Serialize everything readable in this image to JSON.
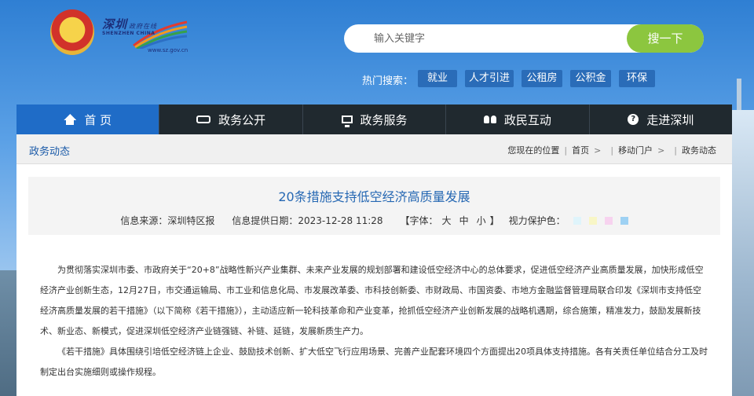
{
  "header": {
    "logo_cn": "深圳",
    "logo_cn_small": "政府在线",
    "logo_en": "SHENZHEN CHINA",
    "logo_url": "www.sz.gov.cn",
    "search_placeholder": "输入关键字",
    "search_button": "搜一下",
    "hot_label": "热门搜索：",
    "hot_tags": [
      "就业",
      "人才引进",
      "公租房",
      "公积金",
      "环保"
    ]
  },
  "nav": {
    "items": [
      {
        "label": "首 页",
        "icon": "home-icon"
      },
      {
        "label": "政务公开",
        "icon": "gov-icon"
      },
      {
        "label": "政务服务",
        "icon": "monitor-icon"
      },
      {
        "label": "政民互动",
        "icon": "people-icon"
      },
      {
        "label": "走进深圳",
        "icon": "info-icon"
      }
    ]
  },
  "crumb": {
    "section": "政务动态",
    "location_label": "您现在的位置",
    "path": [
      "首页",
      "移动门户",
      "政务动态"
    ]
  },
  "article": {
    "title": "20条措施支持低空经济高质量发展",
    "source_label": "信息来源：深圳特区报",
    "date_label": "信息提供日期：2023-12-28 11:28",
    "font_label": "【字体：",
    "font_large": "大",
    "font_medium": "中",
    "font_small": "小",
    "font_close": "】",
    "eye_label": "视力保护色：",
    "swatch_colors": [
      "#dff4fb",
      "#f8f6c6",
      "#f7d3ef",
      "#9ed1f3"
    ],
    "paragraphs": [
      "为贯彻落实深圳市委、市政府关于“20+8”战略性新兴产业集群、未来产业发展的规划部署和建设低空经济中心的总体要求，促进低空经济产业高质量发展，加快形成低空经济产业创新生态，12月27日，市交通运输局、市工业和信息化局、市发展改革委、市科技创新委、市财政局、市国资委、市地方金融监督管理局联合印发《深圳市支持低空经济高质量发展的若干措施》（以下简称《若干措施》），主动适应新一轮科技革命和产业变革，抢抓低空经济产业创新发展的战略机遇期，综合施策，精准发力，鼓励发展新技术、新业态、新模式，促进深圳低空经济产业链强链、补链、延链，发展新质生产力。",
      "《若干措施》具体围绕引培低空经济链上企业、鼓励技术创新、扩大低空飞行应用场景、完善产业配套环境四个方面提出20项具体支持措施。各有关责任单位结合分工及时制定出台实施细则或操作规程。"
    ]
  }
}
